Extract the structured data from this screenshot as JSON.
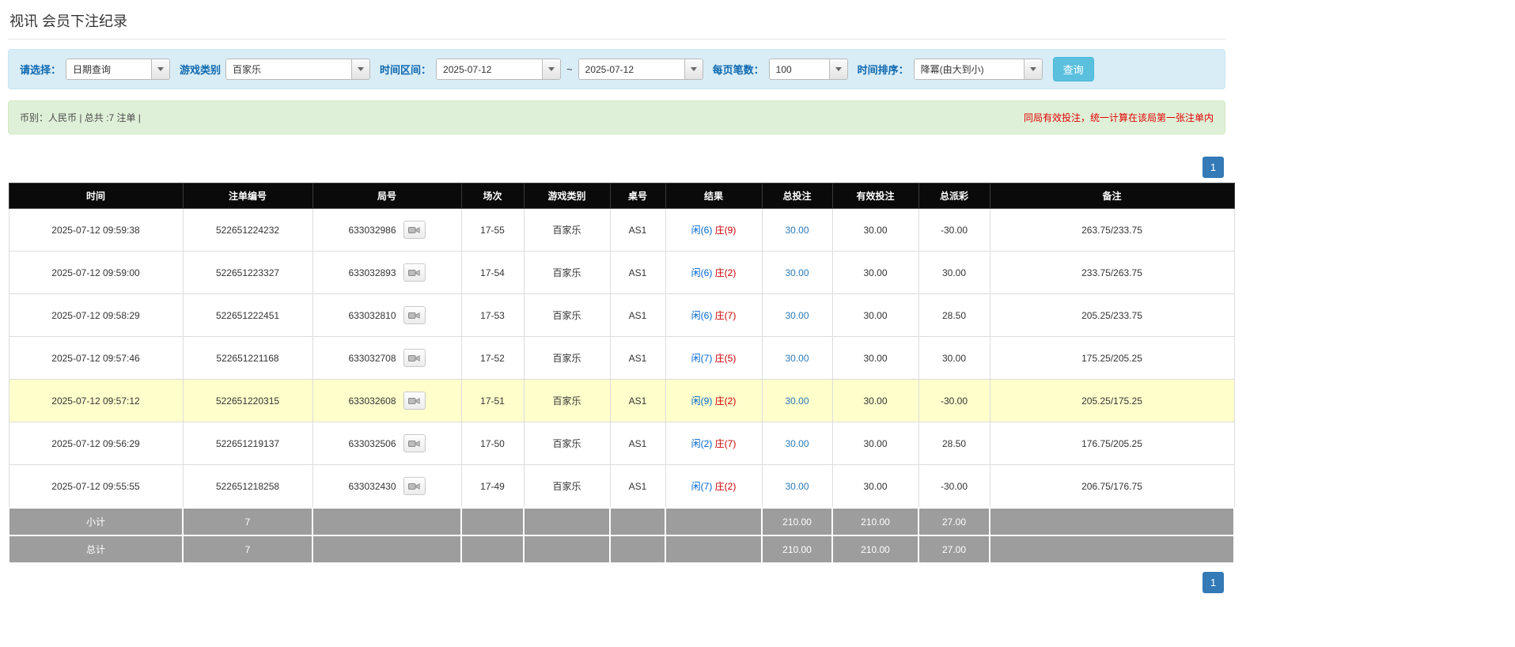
{
  "page": {
    "title": "视讯 会员下注纪录"
  },
  "filters": {
    "select_label": "请选择：",
    "select_value": "日期查询",
    "game_type_label": "游戏类别",
    "game_type_value": "百家乐",
    "time_range_label": "时间区间：",
    "date_from": "2025-07-12",
    "range_separator": "~",
    "date_to": "2025-07-12",
    "page_size_label": "每页笔数：",
    "page_size_value": "100",
    "sort_label": "时间排序：",
    "sort_value": "降冪(由大到小)",
    "search_button": "查询"
  },
  "info_bar": {
    "left": "币别：人民币 | 总共 :7 注单 |",
    "right": "同局有效投注，统一计算在该局第一张注单内"
  },
  "pagination": {
    "page": "1"
  },
  "table": {
    "headers": [
      "时间",
      "注单编号",
      "局号",
      "场次",
      "游戏类别",
      "桌号",
      "结果",
      "总投注",
      "有效投注",
      "总派彩",
      "备注"
    ],
    "rows": [
      {
        "time": "2025-07-12 09:59:38",
        "bet_id": "522651224232",
        "round_id": "633032986",
        "session": "17-55",
        "game": "百家乐",
        "table_no": "AS1",
        "result_player": "闲(6)",
        "result_banker": "庄(9)",
        "total_bet": "30.00",
        "valid_bet": "30.00",
        "payout": "-30.00",
        "remark": "263.75/233.75",
        "highlight": false
      },
      {
        "time": "2025-07-12 09:59:00",
        "bet_id": "522651223327",
        "round_id": "633032893",
        "session": "17-54",
        "game": "百家乐",
        "table_no": "AS1",
        "result_player": "闲(6)",
        "result_banker": "庄(2)",
        "total_bet": "30.00",
        "valid_bet": "30.00",
        "payout": "30.00",
        "remark": "233.75/263.75",
        "highlight": false
      },
      {
        "time": "2025-07-12 09:58:29",
        "bet_id": "522651222451",
        "round_id": "633032810",
        "session": "17-53",
        "game": "百家乐",
        "table_no": "AS1",
        "result_player": "闲(6)",
        "result_banker": "庄(7)",
        "total_bet": "30.00",
        "valid_bet": "30.00",
        "payout": "28.50",
        "remark": "205.25/233.75",
        "highlight": false
      },
      {
        "time": "2025-07-12 09:57:46",
        "bet_id": "522651221168",
        "round_id": "633032708",
        "session": "17-52",
        "game": "百家乐",
        "table_no": "AS1",
        "result_player": "闲(7)",
        "result_banker": "庄(5)",
        "total_bet": "30.00",
        "valid_bet": "30.00",
        "payout": "30.00",
        "remark": "175.25/205.25",
        "highlight": false
      },
      {
        "time": "2025-07-12 09:57:12",
        "bet_id": "522651220315",
        "round_id": "633032608",
        "session": "17-51",
        "game": "百家乐",
        "table_no": "AS1",
        "result_player": "闲(9)",
        "result_banker": "庄(2)",
        "total_bet": "30.00",
        "valid_bet": "30.00",
        "payout": "-30.00",
        "remark": "205.25/175.25",
        "highlight": true
      },
      {
        "time": "2025-07-12 09:56:29",
        "bet_id": "522651219137",
        "round_id": "633032506",
        "session": "17-50",
        "game": "百家乐",
        "table_no": "AS1",
        "result_player": "闲(2)",
        "result_banker": "庄(7)",
        "total_bet": "30.00",
        "valid_bet": "30.00",
        "payout": "28.50",
        "remark": "176.75/205.25",
        "highlight": false
      },
      {
        "time": "2025-07-12 09:55:55",
        "bet_id": "522651218258",
        "round_id": "633032430",
        "session": "17-49",
        "game": "百家乐",
        "table_no": "AS1",
        "result_player": "闲(7)",
        "result_banker": "庄(2)",
        "total_bet": "30.00",
        "valid_bet": "30.00",
        "payout": "-30.00",
        "remark": "206.75/176.75",
        "highlight": false
      }
    ],
    "footer": [
      {
        "label": "小计",
        "count": "7",
        "total_bet": "210.00",
        "valid_bet": "210.00",
        "payout": "27.00"
      },
      {
        "label": "总计",
        "count": "7",
        "total_bet": "210.00",
        "valid_bet": "210.00",
        "payout": "27.00"
      }
    ]
  }
}
